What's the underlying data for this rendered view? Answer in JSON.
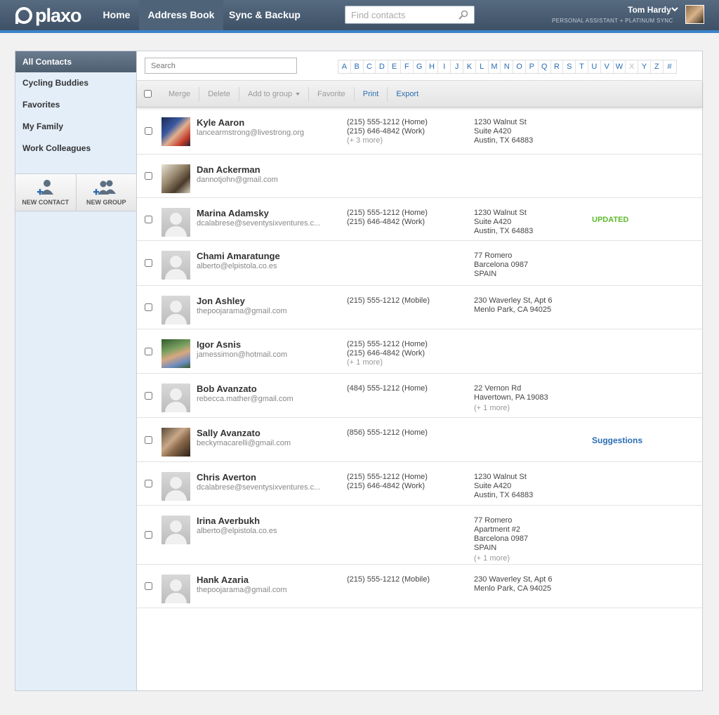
{
  "header": {
    "logo": "plaxo",
    "nav": [
      {
        "label": "Home"
      },
      {
        "label": "Address Book"
      },
      {
        "label": "Sync & Backup"
      }
    ],
    "find_placeholder": "Find contacts",
    "user_name": "Tom Hardy",
    "user_sub": "PERSONAL ASSISTANT  +  PLATINUM SYNC"
  },
  "sidebar": {
    "title": "All Contacts",
    "groups": [
      "Cycling Buddies",
      "Favorites",
      "My Family",
      "Work Colleagues"
    ],
    "new_contact": "NEW CONTACT",
    "new_group": "NEW GROUP"
  },
  "main": {
    "search_placeholder": "Search",
    "alphabet": [
      "A",
      "B",
      "C",
      "D",
      "E",
      "F",
      "G",
      "H",
      "I",
      "J",
      "K",
      "L",
      "M",
      "N",
      "O",
      "P",
      "Q",
      "R",
      "S",
      "T",
      "U",
      "V",
      "W",
      "X",
      "Y",
      "Z",
      "#"
    ],
    "alphabet_disabled": [
      "X"
    ],
    "toolbar": {
      "merge": "Merge",
      "delete": "Delete",
      "add_to_group": "Add to group",
      "favorite": "Favorite",
      "print": "Print",
      "export": "Export"
    },
    "contacts": [
      {
        "name": "Kyle Aaron",
        "email": "lancearmstrong@livestrong.org",
        "phones": [
          "(215) 555-1212 (Home)",
          "(215) 646-4842 (Work)"
        ],
        "phones_more": "(+ 3 more)",
        "address": [
          "1230 Walnut St",
          "Suite A420",
          "Austin, TX 64883"
        ],
        "address_more": "",
        "tag": "",
        "avatar": "photo"
      },
      {
        "name": "Dan Ackerman",
        "email": "dannotjohn@gmail.com",
        "phones": [],
        "phones_more": "",
        "address": [],
        "address_more": "",
        "tag": "",
        "avatar": "photo"
      },
      {
        "name": "Marina Adamsky",
        "email": "dcalabrese@seventysixventures.c...",
        "phones": [
          "(215) 555-1212 (Home)",
          "(215) 646-4842 (Work)"
        ],
        "phones_more": "",
        "address": [
          "1230 Walnut St",
          "Suite A420",
          "Austin, TX 64883"
        ],
        "address_more": "",
        "tag": "UPDATED",
        "avatar": "generic"
      },
      {
        "name": "Chami Amaratunge",
        "email": "alberto@elpistola.co.es",
        "phones": [],
        "phones_more": "",
        "address": [
          "77 Romero",
          "Barcelona 0987",
          "SPAIN"
        ],
        "address_more": "",
        "tag": "",
        "avatar": "generic"
      },
      {
        "name": "Jon Ashley",
        "email": "thepoojarama@gmail.com",
        "phones": [
          "(215) 555-1212 (Mobile)"
        ],
        "phones_more": "",
        "address": [
          "230 Waverley St, Apt 6",
          "Menlo Park, CA 94025"
        ],
        "address_more": "",
        "tag": "",
        "avatar": "generic"
      },
      {
        "name": "Igor Asnis",
        "email": "jamessimon@hotmail.com",
        "phones": [
          "(215) 555-1212 (Home)",
          "(215) 646-4842 (Work)"
        ],
        "phones_more": "(+ 1 more)",
        "address": [],
        "address_more": "",
        "tag": "",
        "avatar": "photo"
      },
      {
        "name": "Bob Avanzato",
        "email": "rebecca.mather@gmail.com",
        "phones": [
          "(484) 555-1212 (Home)"
        ],
        "phones_more": "",
        "address": [
          "22 Vernon Rd",
          "Havertown, PA 19083"
        ],
        "address_more": "(+ 1 more)",
        "tag": "",
        "avatar": "generic"
      },
      {
        "name": "Sally Avanzato",
        "email": "beckymacarelli@gmail.com",
        "phones": [
          "(856) 555-1212 (Home)"
        ],
        "phones_more": "",
        "address": [],
        "address_more": "",
        "tag": "Suggestions",
        "avatar": "photo"
      },
      {
        "name": "Chris Averton",
        "email": "dcalabrese@seventysixventures.c...",
        "phones": [
          "(215) 555-1212 (Home)",
          "(215) 646-4842 (Work)"
        ],
        "phones_more": "",
        "address": [
          "1230 Walnut St",
          "Suite A420",
          "Austin, TX 64883"
        ],
        "address_more": "",
        "tag": "",
        "avatar": "generic"
      },
      {
        "name": "Irina Averbukh",
        "email": "alberto@elpistola.co.es",
        "phones": [],
        "phones_more": "",
        "address": [
          "77 Romero",
          "Apartment #2",
          "Barcelona 0987",
          "SPAIN"
        ],
        "address_more": "(+ 1 more)",
        "tag": "",
        "avatar": "generic"
      },
      {
        "name": "Hank Azaria",
        "email": "thepoojarama@gmail.com",
        "phones": [
          "(215) 555-1212 (Mobile)"
        ],
        "phones_more": "",
        "address": [
          "230 Waverley St, Apt 6",
          "Menlo Park, CA 94025"
        ],
        "address_more": "",
        "tag": "",
        "avatar": "generic"
      }
    ]
  },
  "colors": {
    "link": "#2a6db3",
    "updated": "#5cbb2a",
    "header": "#4a5d72",
    "header_accent": "#3a83c9"
  }
}
